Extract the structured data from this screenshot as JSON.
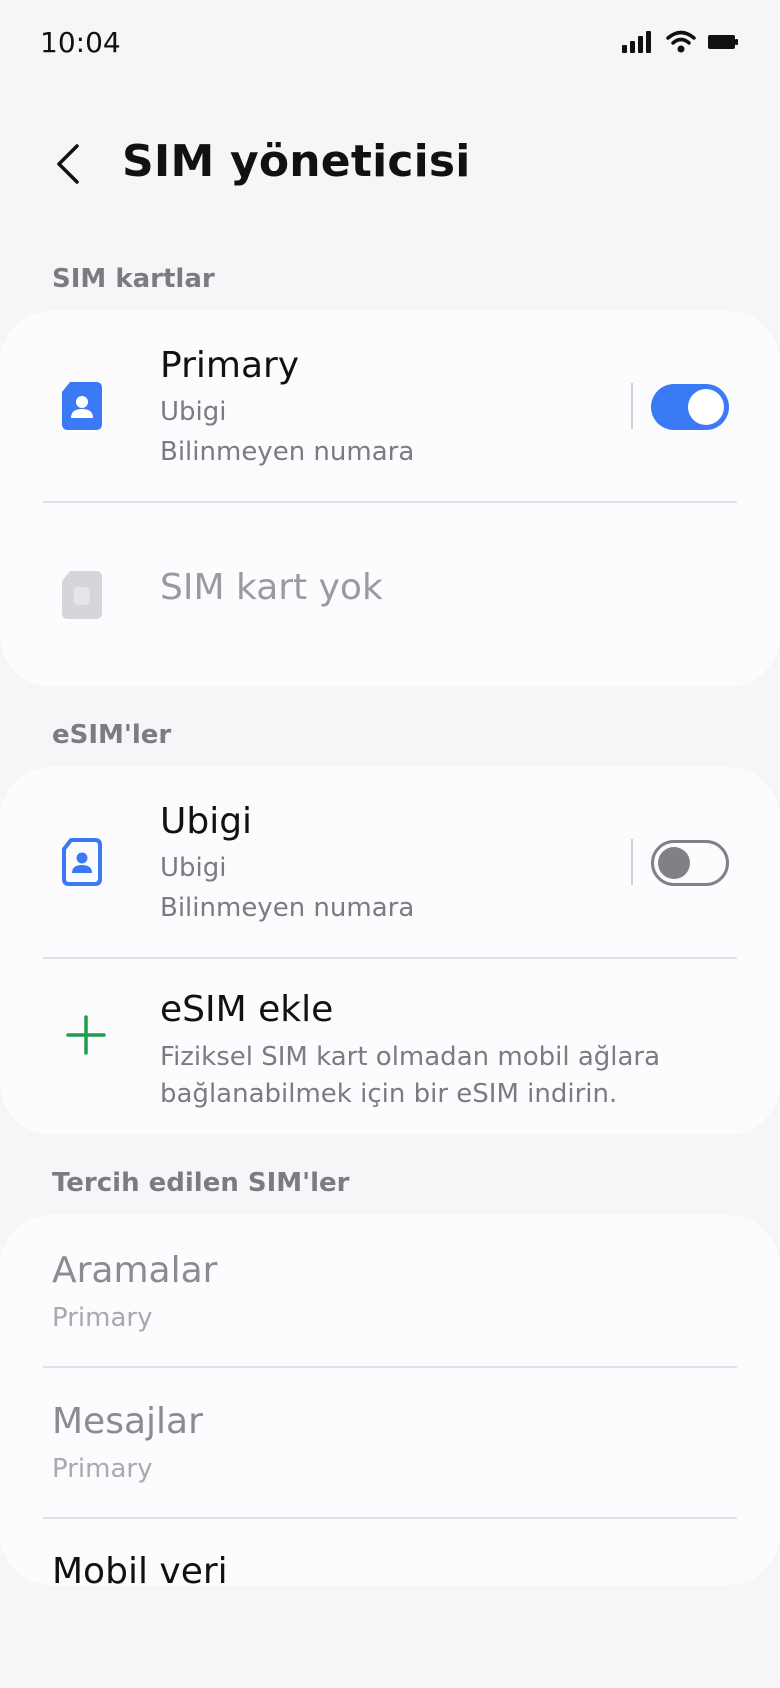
{
  "status_bar": {
    "time": "10:04",
    "icons": [
      "signal-icon",
      "wifi-icon",
      "battery-icon"
    ]
  },
  "header": {
    "back_icon": "chevron-left-icon",
    "title": "SIM yöneticisi"
  },
  "sim_cards": {
    "section_label": "SIM kartlar",
    "items": [
      {
        "title": "Primary",
        "carrier": "Ubigi",
        "number": "Bilinmeyen numara",
        "icon": "sim-card-icon",
        "enabled": true
      },
      {
        "title": "SIM kart yok",
        "icon": "sim-card-empty-icon"
      }
    ]
  },
  "esims": {
    "section_label": "eSIM'ler",
    "items": [
      {
        "title": "Ubigi",
        "carrier": "Ubigi",
        "number": "Bilinmeyen numara",
        "icon": "esim-icon",
        "enabled": false
      }
    ],
    "add": {
      "title": "eSIM ekle",
      "description": "Fiziksel SIM kart olmadan mobil ağlara bağlanabilmek için bir eSIM indirin.",
      "icon": "plus-icon"
    }
  },
  "preferred_sims": {
    "section_label": "Tercih edilen SIM'ler",
    "items": [
      {
        "title": "Aramalar",
        "value": "Primary"
      },
      {
        "title": "Mesajlar",
        "value": "Primary"
      },
      {
        "title": "Mobil veri"
      }
    ]
  },
  "colors": {
    "accent": "#3a7bf5",
    "add_icon": "#1f9d4d",
    "background": "#f6f6f8",
    "card": "#fcfcfe"
  }
}
